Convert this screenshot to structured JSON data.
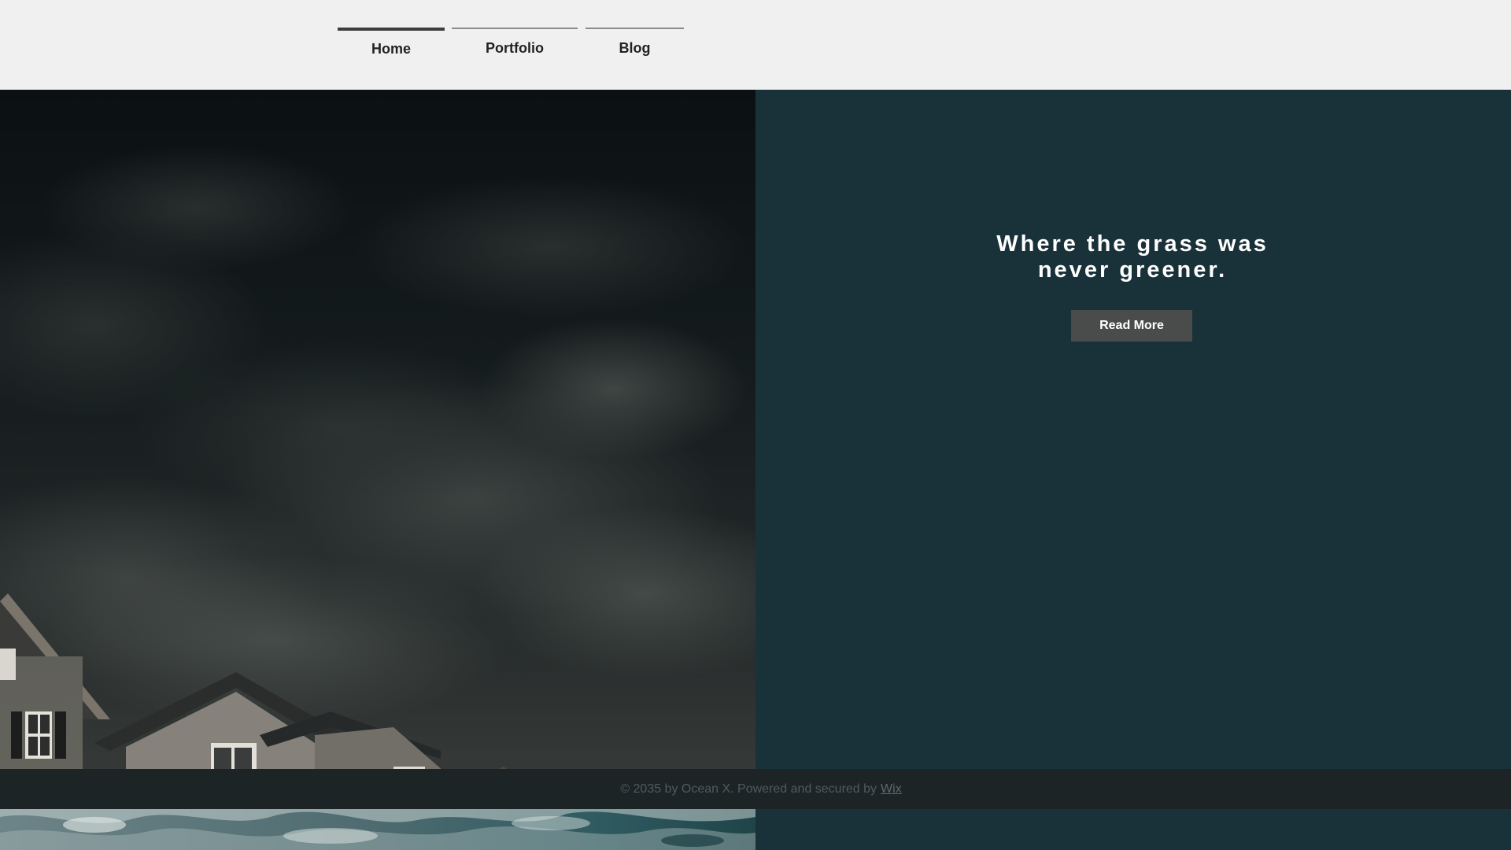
{
  "nav": {
    "items": [
      {
        "label": "Home",
        "active": true
      },
      {
        "label": "Portfolio",
        "active": false
      },
      {
        "label": "Blog",
        "active": false
      }
    ]
  },
  "hero": {
    "headline_line1": "Where the grass was",
    "headline_line2": "never greener.",
    "button_label": "Read More"
  },
  "footer": {
    "text": "© 2035 by Ocean X. Powered and secured by",
    "link_label": "Wix"
  },
  "colors": {
    "header_bg": "#f0f0f0",
    "panel_teal": "#193138",
    "button_bg": "#4a4b4b",
    "footer_bg": "#1c2426"
  },
  "icons": {
    "left_image": "storm-clouds-over-houses-image",
    "bottom_image": "ocean-waves-image"
  }
}
